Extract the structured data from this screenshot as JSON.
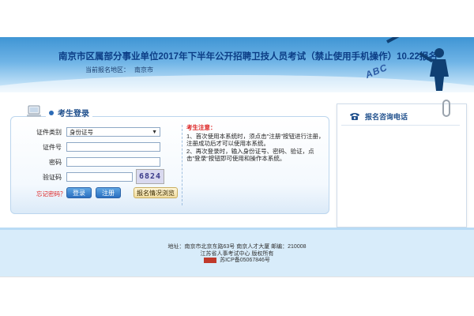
{
  "header": {
    "title": "南京市区属部分事业单位2017年下半年公开招聘卫技人员考试（禁止使用手机操作）10.22报名",
    "region_label": "当前报名地区：",
    "region_value": "南京市",
    "decor_text": "ABC"
  },
  "login": {
    "section_title": "考生登录",
    "id_type_label": "证件类别",
    "id_type_value": "身份证号",
    "id_number_label": "证件号",
    "password_label": "密码",
    "captcha_label": "验证码",
    "captcha_code": "6824",
    "forgot_link": "忘记密码？",
    "login_button": "登录",
    "register_button": "注册",
    "browse_button": "报名情况浏览"
  },
  "notice": {
    "title": "考生注意：",
    "lines": [
      "1、首次使用本系统时，须点击\"注册\"按钮进行注册，注册成功后才可以使用本系统。",
      "2、再次登录时，输入身份证号、密码、验证，点击\"登录\"按钮即可使用和操作本系统。"
    ]
  },
  "consult": {
    "title": "报名咨询电话"
  },
  "footer": {
    "address": "地址：南京市北京东路63号 南京人才大厦 邮编：210008",
    "copyright": "江苏省人事考试中心 版权所有",
    "icp": "苏ICP备05067846号"
  },
  "colors": {
    "banner_top": "#3f95d4",
    "title": "#0b3d86",
    "accent": "#2c6bb6",
    "notice_title": "#d22222",
    "footer_bg": "#d8ecfa"
  }
}
